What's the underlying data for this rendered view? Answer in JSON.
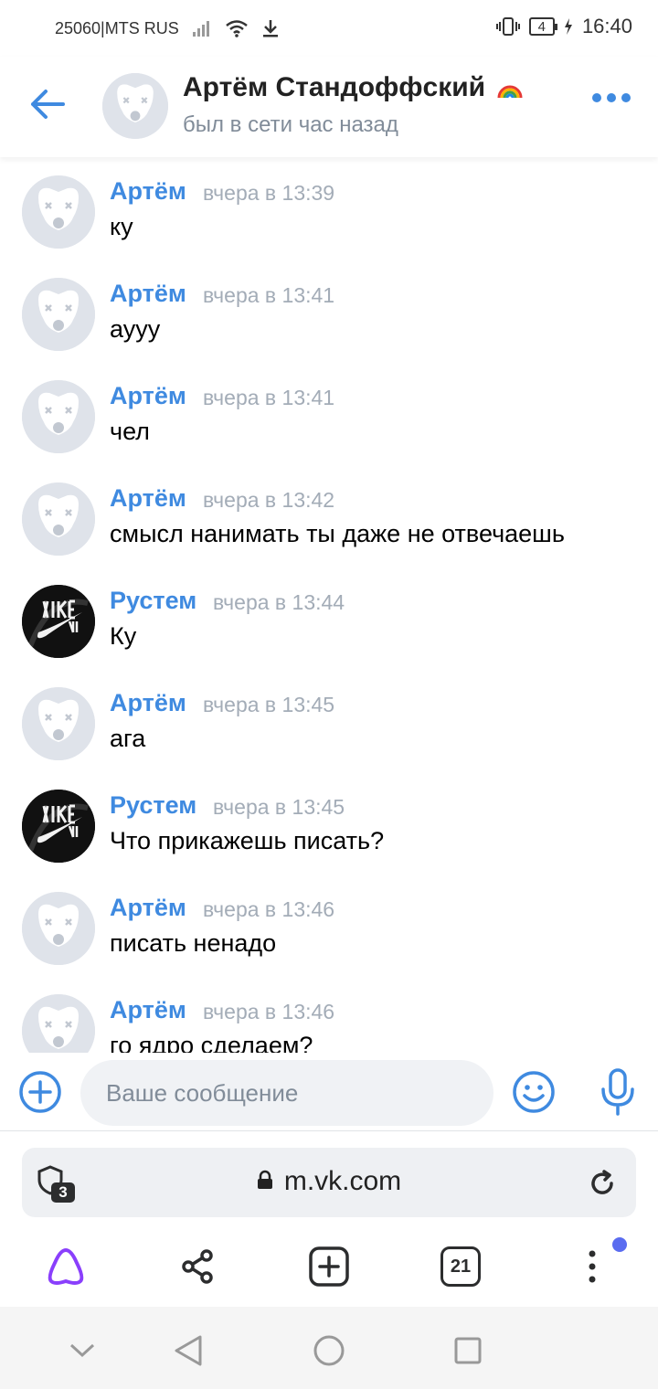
{
  "status_bar": {
    "carrier": "25060|MTS RUS",
    "battery": "4",
    "time": "16:40"
  },
  "header": {
    "name": "Артём Стандоффский",
    "badge_icon": "rainbow-icon",
    "status": "был в сети час назад"
  },
  "messages": [
    {
      "author": "Артём",
      "time": "вчера в 13:39",
      "text": "ку",
      "avatar": "deactivated-dog"
    },
    {
      "author": "Артём",
      "time": "вчера в 13:41",
      "text": "ауyy",
      "avatar": "deactivated-dog"
    },
    {
      "author": "Артём",
      "time": "вчера в 13:41",
      "text": "чел",
      "avatar": "deactivated-dog"
    },
    {
      "author": "Артём",
      "time": "вчера в 13:42",
      "text": "смысл нанимать ты даже не отвечаешь",
      "avatar": "deactivated-dog"
    },
    {
      "author": "Рустем",
      "time": "вчера в 13:44",
      "text": "Ку",
      "avatar": "nike-air"
    },
    {
      "author": "Артём",
      "time": "вчера в 13:45",
      "text": "ага",
      "avatar": "deactivated-dog"
    },
    {
      "author": "Рустем",
      "time": "вчера в 13:45",
      "text": "Что прикажешь писать?",
      "avatar": "nike-air"
    },
    {
      "author": "Артём",
      "time": "вчера в 13:46",
      "text": "писать ненадо",
      "avatar": "deactivated-dog"
    },
    {
      "author": "Артём",
      "time": "вчера в 13:46",
      "text": "го ядро сделаем?",
      "avatar": "deactivated-dog"
    }
  ],
  "composer": {
    "placeholder": "Ваше сообщение"
  },
  "browser": {
    "url": "m.vk.com",
    "shield_count": "3",
    "tabs_count": "21"
  },
  "colors": {
    "accent": "#3f8ae0",
    "time_grey": "#a3acb7",
    "alice_purple": "#8a3ffc"
  }
}
